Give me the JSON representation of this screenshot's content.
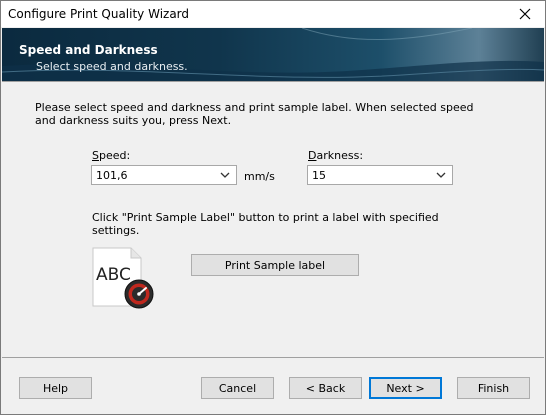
{
  "window": {
    "title": "Configure Print Quality Wizard"
  },
  "banner": {
    "title": "Speed and Darkness",
    "subtitle": "Select speed and darkness."
  },
  "instructions": "Please select speed and darkness and print sample label. When selected speed and darkness suits you, press Next.",
  "speed": {
    "label": "Speed:",
    "value": "101,6",
    "unit": "mm/s"
  },
  "darkness": {
    "label": "Darkness:",
    "value": "15"
  },
  "sample": {
    "text": "Click \"Print Sample Label\" button to print a label with specified settings.",
    "icon_text": "ABC",
    "button_label": "Print Sample label"
  },
  "buttons": {
    "help": "Help",
    "cancel": "Cancel",
    "back": "< Back",
    "next": "Next >",
    "finish": "Finish"
  },
  "colors": {
    "banner_dark": "#0b2a3f",
    "accent": "#0078d7",
    "gauge_red": "#c0281e"
  }
}
